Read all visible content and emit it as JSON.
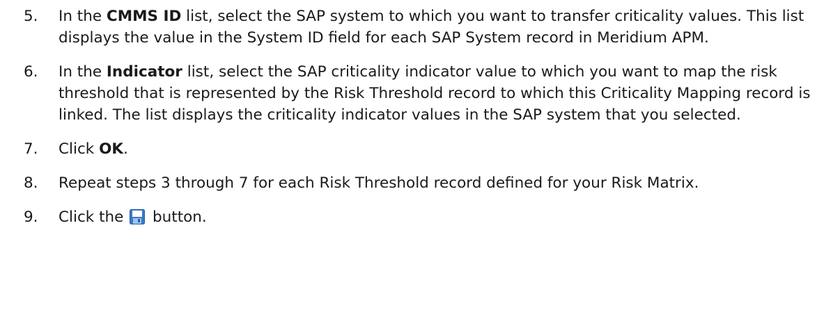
{
  "steps": [
    {
      "number": "5.",
      "pre": "In the ",
      "bold": "CMMS ID",
      "post": " list, select the SAP system to which you want to transfer criticality values. This list displays the value in the System ID field for each SAP System record in Meridium APM."
    },
    {
      "number": "6.",
      "pre": "In the ",
      "bold": "Indicator",
      "post": " list, select the SAP criticality indicator value to which you want to map the risk threshold that is represented by the Risk Threshold record to which this Criticality Mapping record is linked. The list displays the criticality indicator values in the SAP system that you selected."
    },
    {
      "number": "7.",
      "pre": "Click ",
      "bold": "OK",
      "post": "."
    },
    {
      "number": "8.",
      "text": "Repeat steps 3 through 7 for each Risk Threshold record defined for your Risk Matrix."
    },
    {
      "number": "9.",
      "pre": "Click the ",
      "icon": "save-icon",
      "post": " button."
    }
  ],
  "colors": {
    "text": "#1a1a1a",
    "save_icon_blue": "#3a78c8",
    "save_icon_white": "#ffffff"
  }
}
